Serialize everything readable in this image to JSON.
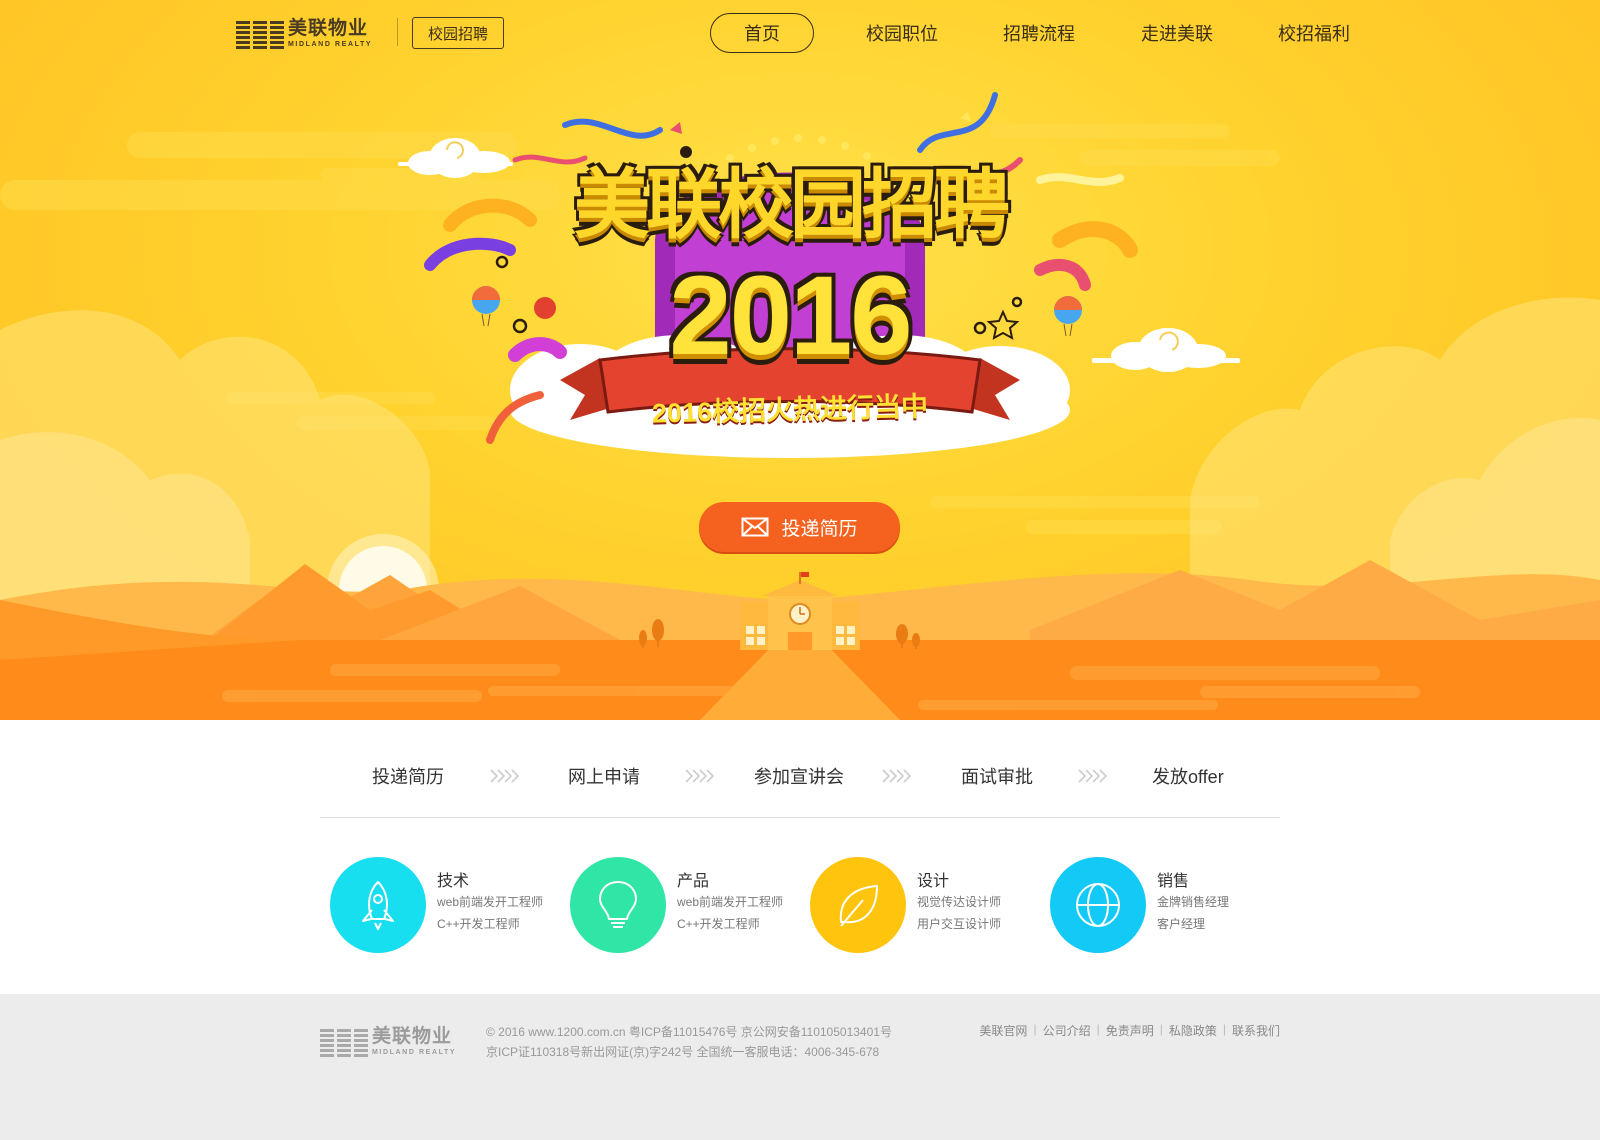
{
  "header": {
    "logo_cn": "美联物业",
    "logo_en": "MIDLAND REALTY",
    "campus_tag": "校园招聘",
    "nav": [
      {
        "label": "首页",
        "active": true
      },
      {
        "label": "校园职位"
      },
      {
        "label": "招聘流程"
      },
      {
        "label": "走进美联"
      },
      {
        "label": "校招福利"
      }
    ]
  },
  "hero": {
    "title": "美联校园招聘",
    "year": "2016",
    "ribbon": "2016校招火热进行当中",
    "cta_label": "投递简历",
    "cta_icon": "envelope-icon"
  },
  "process": {
    "steps": [
      "投递简历",
      "网上申请",
      "参加宣讲会",
      "面试审批",
      "发放offer"
    ]
  },
  "categories": [
    {
      "title": "技术",
      "lines": [
        "web前端发开工程师",
        "C++开发工程师"
      ],
      "icon": "rocket-icon",
      "color": "#17dff0"
    },
    {
      "title": "产品",
      "lines": [
        "web前端发开工程师",
        "C++开发工程师"
      ],
      "icon": "lightbulb-icon",
      "color": "#2fe6a6"
    },
    {
      "title": "设计",
      "lines": [
        "视觉传达设计师",
        "用户交互设计师"
      ],
      "icon": "leaf-icon",
      "color": "#ffc40d"
    },
    {
      "title": "销售",
      "lines": [
        "金牌销售经理",
        "客户经理"
      ],
      "icon": "globe-icon",
      "color": "#13c9f5"
    }
  ],
  "footer": {
    "logo_cn": "美联物业",
    "logo_en": "MIDLAND REALTY",
    "copy_line1": "© 2016 www.1200.com.cn 粤ICP备11015476号 京公网安备110105013401号",
    "copy_line2": "京ICP证110318号新出网证(京)字242号 全国统一客服电话：4006-345-678",
    "links": [
      "美联官网",
      "公司介绍",
      "免责声明",
      "私隐政策",
      "联系我们"
    ]
  }
}
